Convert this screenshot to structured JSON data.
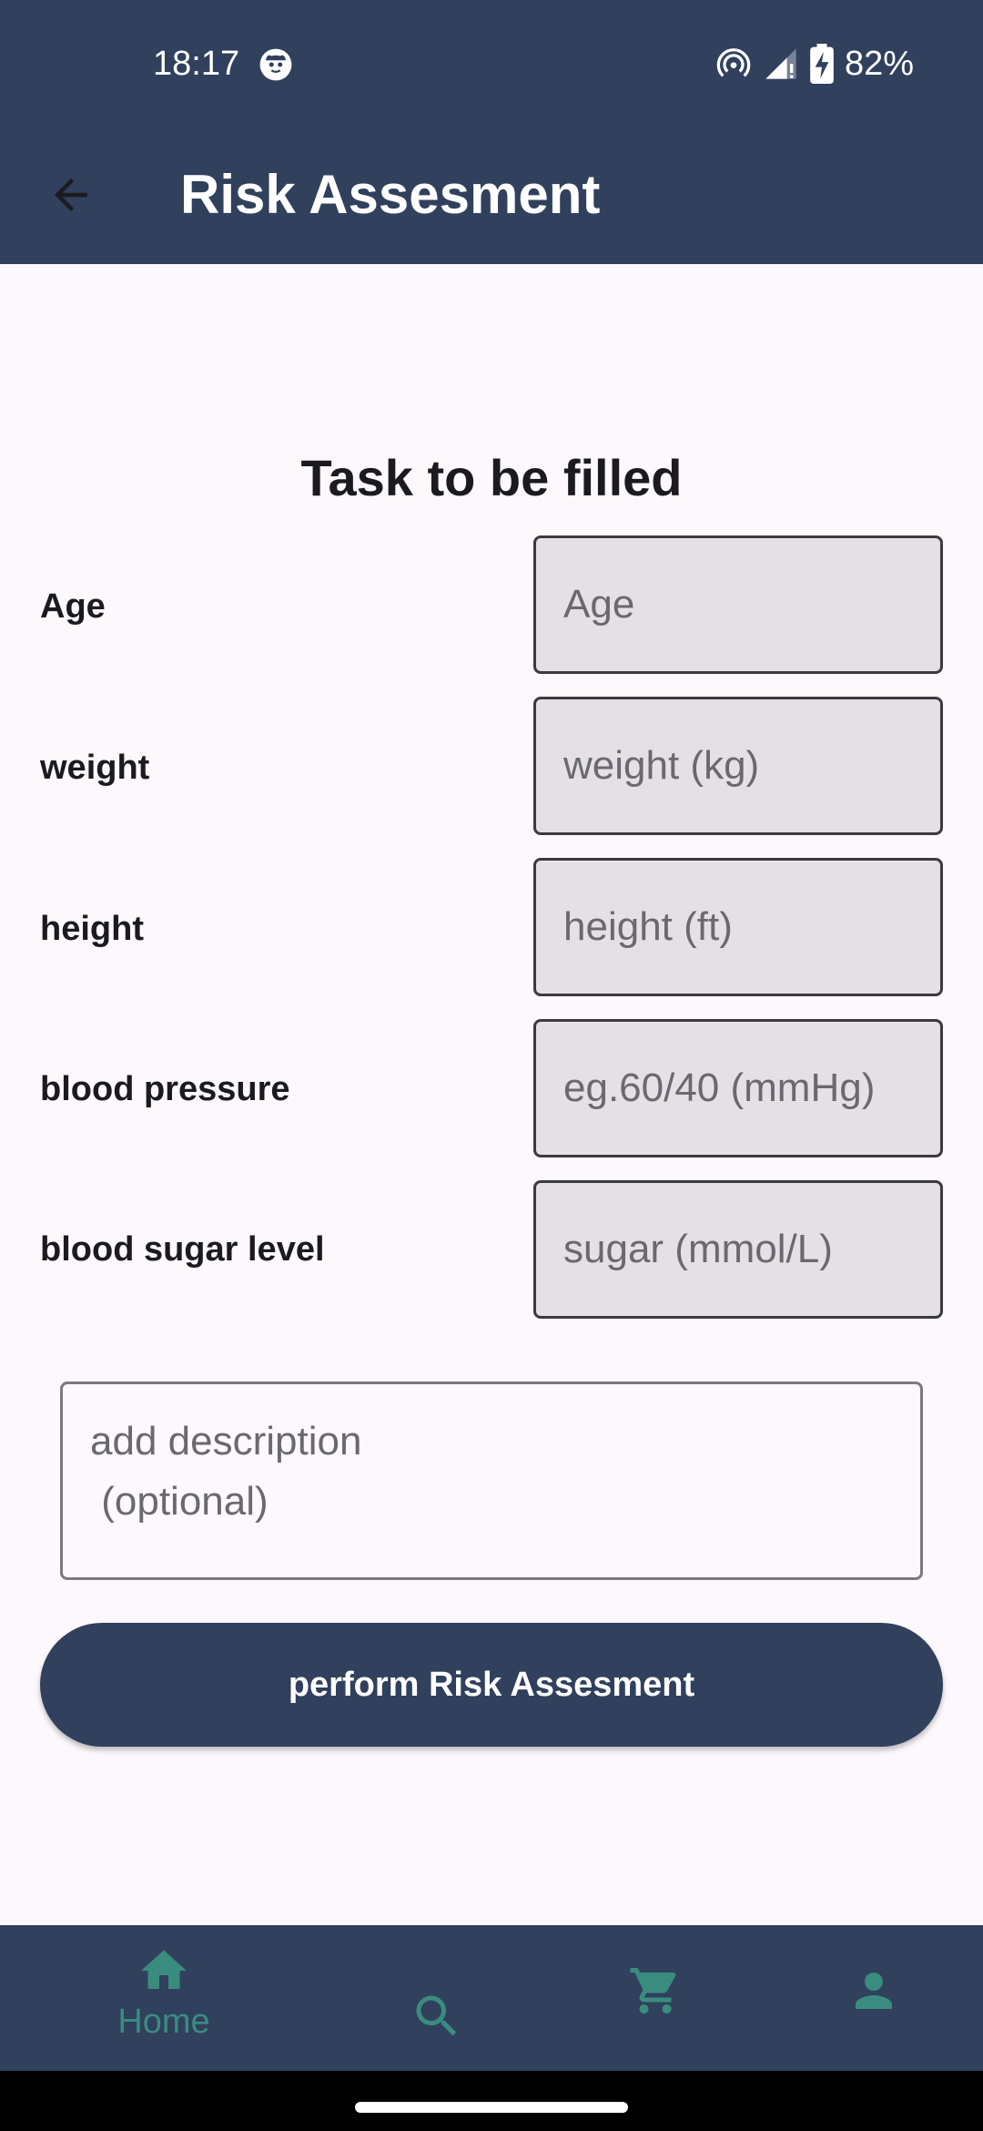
{
  "status_bar": {
    "time": "18:17",
    "battery": "82%",
    "notification_icon": "cat-face-icon",
    "icons": [
      "hotspot-icon",
      "signal-icon",
      "battery-charging-icon"
    ]
  },
  "app_bar": {
    "title": "Risk Assesment",
    "back_icon": "arrow-back-icon"
  },
  "form": {
    "title": "Task to be filled",
    "fields": [
      {
        "label": "Age",
        "value": "",
        "placeholder": "Age"
      },
      {
        "label": "weight",
        "value": "",
        "placeholder": "weight (kg)"
      },
      {
        "label": "height",
        "value": "",
        "placeholder": "height (ft)"
      },
      {
        "label": "blood pressure",
        "value": "",
        "placeholder": "eg.60/40 (mmHg)"
      },
      {
        "label": "blood sugar level",
        "value": "",
        "placeholder": "sugar (mmol/L)"
      }
    ],
    "description": {
      "value": "",
      "placeholder": "add description\n (optional)"
    },
    "submit_label": "perform Risk Assesment"
  },
  "bottom_nav": {
    "items": [
      {
        "label": "Home",
        "icon": "home-icon",
        "active": true
      },
      {
        "label": "",
        "icon": "search-icon",
        "active": false
      },
      {
        "label": "",
        "icon": "cart-icon",
        "active": false
      },
      {
        "label": "",
        "icon": "person-icon",
        "active": false
      }
    ]
  },
  "colors": {
    "primary": "#30405D",
    "accent": "#3A8C7E",
    "background": "#FDF8FC",
    "field_fill": "#E5E0E5"
  }
}
